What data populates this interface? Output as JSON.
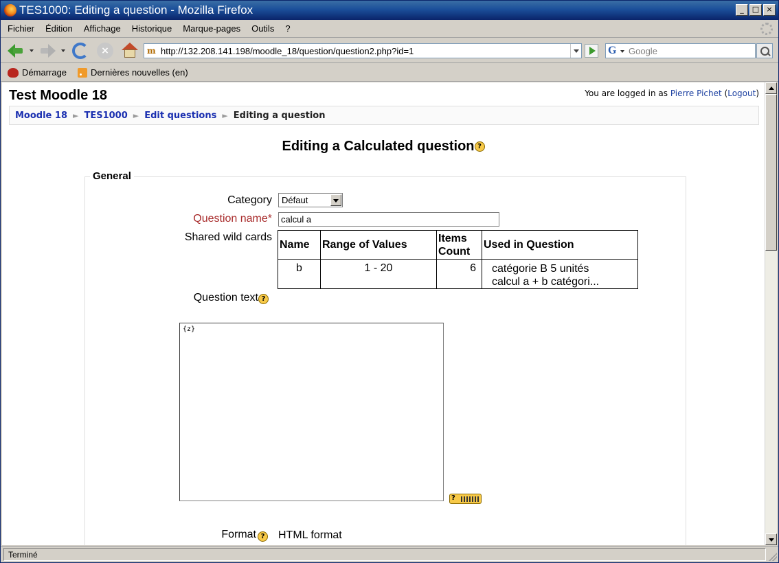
{
  "window": {
    "title": "TES1000: Editing a question - Mozilla Firefox",
    "buttons": [
      "_",
      "□",
      "×"
    ]
  },
  "menu": [
    "Fichier",
    "Édition",
    "Affichage",
    "Historique",
    "Marque-pages",
    "Outils",
    "?"
  ],
  "navbar": {
    "url": "http://132.208.141.198/moodle_18/question/question2.php?id=1",
    "search_engine": "G",
    "search_placeholder": "Google",
    "stop_glyph": "×"
  },
  "bookmarks": [
    "Démarrage",
    "Dernières nouvelles (en)"
  ],
  "page": {
    "site_title": "Test Moodle 18",
    "login_prefix": "You are logged in as ",
    "user_name": "Pierre Pichet",
    "logout": "Logout",
    "breadcrumb": [
      "Moodle 18",
      "TES1000",
      "Edit questions",
      "Editing a question"
    ],
    "breadcrumb_sep": "►",
    "heading": "Editing a Calculated question",
    "help_glyph": "?",
    "fieldset_legend": "General",
    "fields": {
      "category_label": "Category",
      "category_value": "Défaut",
      "question_name_label": "Question name*",
      "question_name_value": "calcul a",
      "shared_wild_cards_label": "Shared wild cards",
      "question_text_label": "Question text",
      "question_text_value": "{z}",
      "format_label": "Format",
      "format_value": "HTML format"
    },
    "wild_cards": {
      "headers": [
        "Name",
        "Range of Values",
        "Items Count",
        "Used in Question"
      ],
      "header_items_line1": "Items",
      "header_items_line2": "Count",
      "rows": [
        {
          "name": "b",
          "range": "1 - 20",
          "count": "6",
          "used_1": "catégorie B 5 unités",
          "used_2": "calcul a + b catégori..."
        }
      ]
    }
  },
  "status": "Terminé"
}
